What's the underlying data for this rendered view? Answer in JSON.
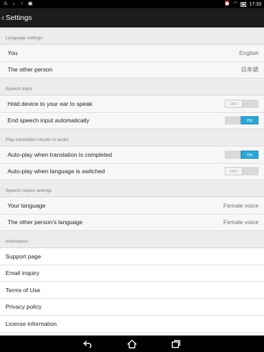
{
  "status_bar": {
    "time": "17:33",
    "left_icons": [
      "warning-icon",
      "download-icon",
      "upload-icon",
      "image-icon"
    ],
    "right_icons": [
      "alarm-icon",
      "wifi-icon",
      "battery-icon"
    ]
  },
  "action_bar": {
    "back_glyph": "‹",
    "title": "Settings"
  },
  "sections": {
    "language": {
      "header": "Language settings",
      "you_label": "You",
      "you_value": "English",
      "other_label": "The other person",
      "other_value": "日本語"
    },
    "speech_input": {
      "header": "Speech input",
      "ear_label": "Hold device to your ear to speak",
      "ear_toggle": "OFF",
      "end_label": "End speech input automatically",
      "end_toggle": "ON"
    },
    "play_audio": {
      "header": "Play translation results in audio",
      "auto_translation_label": "Auto-play when translation is completed",
      "auto_translation_toggle": "ON",
      "auto_language_label": "Auto-play when language is switched",
      "auto_language_toggle": "OFF"
    },
    "speech_output": {
      "header": "Speech output settings",
      "your_language_label": "Your language",
      "your_language_value": "Female voice",
      "other_language_label": "The other person's language",
      "other_language_value": "Female voice"
    },
    "information": {
      "header": "Information",
      "items": [
        "Support page",
        "Email inquiry",
        "Terms of Use",
        "Privacy policy",
        "License information"
      ]
    }
  },
  "colors": {
    "toggle_on": "#2aa6d6",
    "action_bar": "#1c1c1c",
    "section_header_bg": "#ececec"
  }
}
